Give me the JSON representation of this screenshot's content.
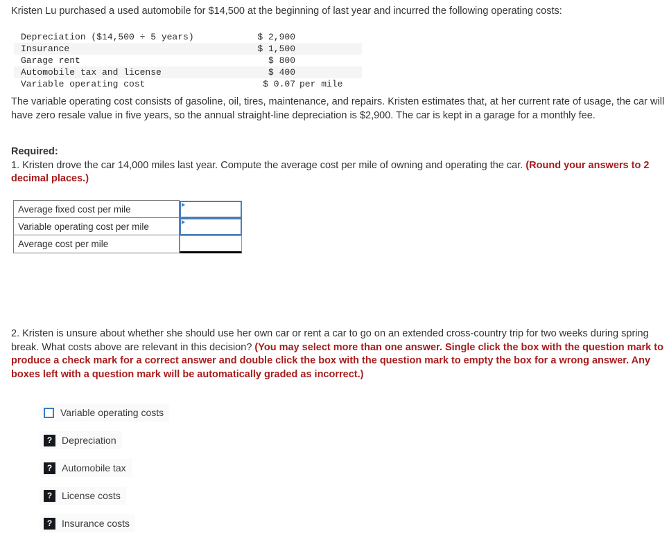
{
  "intro": {
    "text": "Kristen Lu purchased a used automobile for $14,500 at the beginning of last year and incurred the following operating costs:"
  },
  "cost_table": {
    "rows": [
      {
        "label": "Depreciation ($14,500 ÷ 5 years)",
        "amount": "$ 2,900",
        "unit": ""
      },
      {
        "label": "Insurance",
        "amount": "$ 1,500",
        "unit": ""
      },
      {
        "label": "Garage rent",
        "amount": "$ 800",
        "unit": ""
      },
      {
        "label": "Automobile tax and license",
        "amount": "$ 400",
        "unit": ""
      },
      {
        "label": "Variable operating cost",
        "amount": "$ 0.07",
        "unit": "per mile"
      }
    ]
  },
  "paragraphs": {
    "variable_cost": "The variable operating cost consists of gasoline, oil, tires, maintenance, and repairs. Kristen estimates that, at her current rate of usage, the car will have zero resale value in five years, so the annual straight-line depreciation is $2,900. The car is kept in a garage for a monthly fee."
  },
  "required": {
    "label": "Required:",
    "question1": "1. Kristen drove the car 14,000 miles last year. Compute the average cost per mile of owning and operating the car.",
    "question1_note": "(Round your answers to 2 decimal places.)"
  },
  "answer_table": {
    "rows": [
      {
        "label": "Average fixed cost per mile",
        "value": "",
        "style": "blue"
      },
      {
        "label": "Variable operating cost per mile",
        "value": "",
        "style": "blue"
      },
      {
        "label": "Average cost per mile",
        "value": "",
        "style": "plain"
      }
    ]
  },
  "question2": {
    "text": "2. Kristen is unsure about whether she should use her own car or rent a car to go on an extended cross-country trip for two weeks during spring break. What costs above are relevant in this decision?",
    "note": "(You may select more than one answer. Single click the box with the question mark to produce a check mark for a correct answer and double click the box with the question mark to empty the box for a wrong answer. Any boxes left with a question mark will be automatically graded as incorrect.)",
    "options": [
      {
        "label": "Variable operating costs",
        "state": "empty",
        "glyph": ""
      },
      {
        "label": "Depreciation",
        "state": "question",
        "glyph": "?"
      },
      {
        "label": "Automobile tax",
        "state": "question",
        "glyph": "?"
      },
      {
        "label": "License costs",
        "state": "question",
        "glyph": "?"
      },
      {
        "label": "Insurance costs",
        "state": "question",
        "glyph": "?"
      }
    ]
  },
  "colors": {
    "text": "#333333",
    "red_note": "#a81c1c",
    "input_blue": "#4a7ebb",
    "checkbox_blue": "#3a7ac8",
    "question_box": "#15181c",
    "stripe": "#f5f5f5"
  }
}
